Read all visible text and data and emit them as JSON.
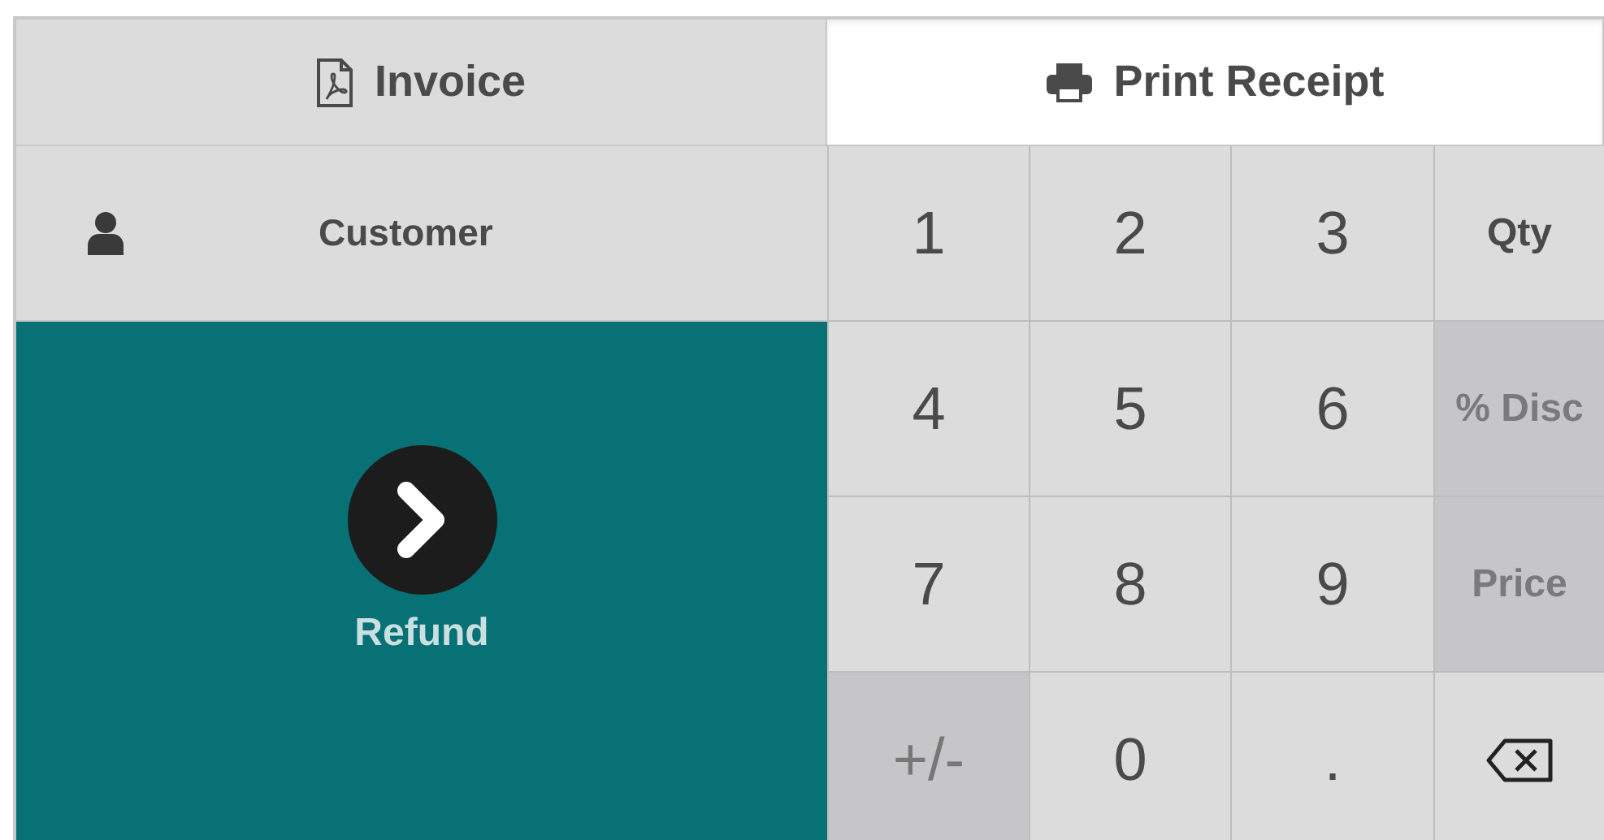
{
  "actions": [
    {
      "label": "Invoice",
      "highlighted": false
    },
    {
      "label": "Print Receipt",
      "highlighted": true
    }
  ],
  "customer": {
    "label": "Customer"
  },
  "payment": {
    "label": "Refund"
  },
  "keypad": [
    {
      "kind": "digit",
      "label": "1"
    },
    {
      "kind": "digit",
      "label": "2"
    },
    {
      "kind": "digit",
      "label": "3"
    },
    {
      "kind": "mode",
      "label": "Qty",
      "selected": true
    },
    {
      "kind": "digit",
      "label": "4"
    },
    {
      "kind": "digit",
      "label": "5"
    },
    {
      "kind": "digit",
      "label": "6"
    },
    {
      "kind": "mode",
      "label": "% Disc",
      "selected": false
    },
    {
      "kind": "digit",
      "label": "7"
    },
    {
      "kind": "digit",
      "label": "8"
    },
    {
      "kind": "digit",
      "label": "9"
    },
    {
      "kind": "mode",
      "label": "Price",
      "selected": false
    },
    {
      "kind": "sign",
      "label": "+/-"
    },
    {
      "kind": "digit",
      "label": "0"
    },
    {
      "kind": "digit",
      "label": "."
    },
    {
      "kind": "backspace"
    }
  ]
}
